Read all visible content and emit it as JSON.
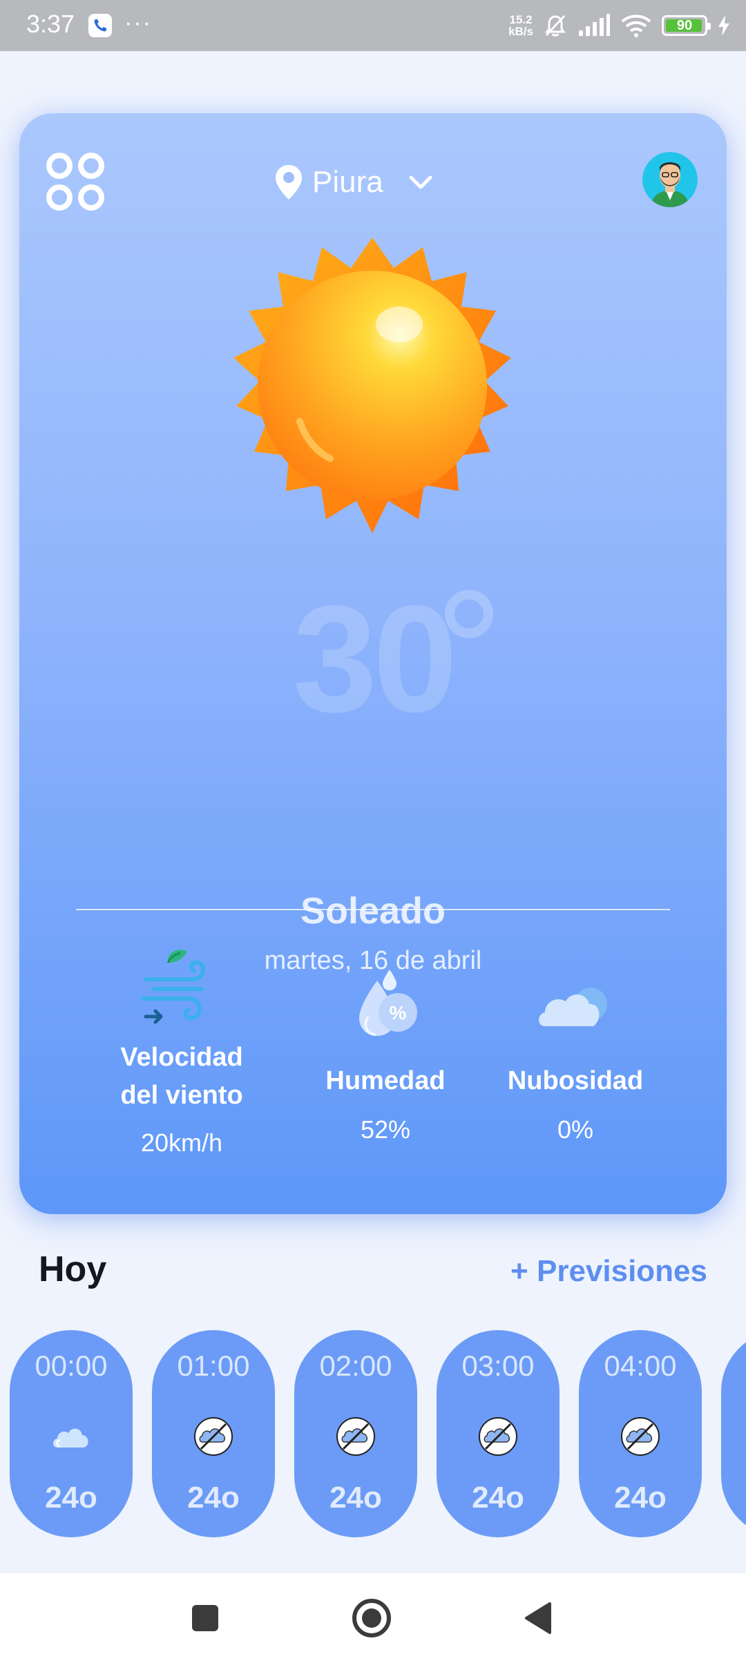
{
  "status_bar": {
    "time": "3:37",
    "more": "···",
    "net_speed_value": "15.2",
    "net_speed_unit": "kB/s",
    "battery_level": "90"
  },
  "header": {
    "location": "Piura"
  },
  "current": {
    "temperature": "30",
    "condition": "Soleado",
    "date": "martes, 16 de abril"
  },
  "stats": [
    {
      "label_line1": "Velocidad",
      "label_line2": "del viento",
      "value": "20km/h",
      "icon": "wind-icon"
    },
    {
      "label": "Humedad",
      "value": "52%",
      "icon": "humidity-icon"
    },
    {
      "label": "Nubosidad",
      "value": "0%",
      "icon": "cloud-icon"
    }
  ],
  "today": {
    "title": "Hoy",
    "forecast_link": "+ Previsiones",
    "hours": [
      {
        "time": "00:00",
        "temp": "24o",
        "icon": "cloud-icon"
      },
      {
        "time": "01:00",
        "temp": "24o",
        "icon": "no-cloud-icon"
      },
      {
        "time": "02:00",
        "temp": "24o",
        "icon": "no-cloud-icon"
      },
      {
        "time": "03:00",
        "temp": "24o",
        "icon": "no-cloud-icon"
      },
      {
        "time": "04:00",
        "temp": "24o",
        "icon": "no-cloud-icon"
      }
    ]
  },
  "colors": {
    "accent": "#5d8ef0",
    "card_top": "#abc8fd",
    "card_bottom": "#5e97f8",
    "pill": "#6b9bf6"
  }
}
